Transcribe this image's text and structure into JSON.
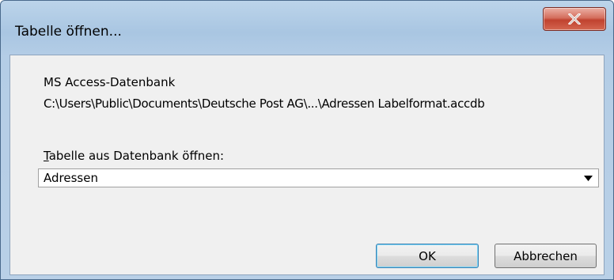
{
  "window": {
    "title": "Tabelle öffnen..."
  },
  "content": {
    "db_type": "MS Access-Datenbank",
    "db_path": "C:\\Users\\Public\\Documents\\Deutsche Post AG\\...\\Adressen Labelformat.accdb",
    "table_label_accel": "T",
    "table_label_rest": "abelle aus Datenbank öffnen:",
    "table_select_value": "Adressen"
  },
  "buttons": {
    "ok": "OK",
    "cancel": "Abbrechen"
  },
  "icons": {
    "close": "close-icon",
    "dropdown": "chevron-down-icon"
  },
  "colors": {
    "title_bar": "#a9c6e2",
    "close_button": "#c0422f",
    "dialog_body": "#f0f0f0",
    "default_button_border": "#3c7fb1"
  }
}
